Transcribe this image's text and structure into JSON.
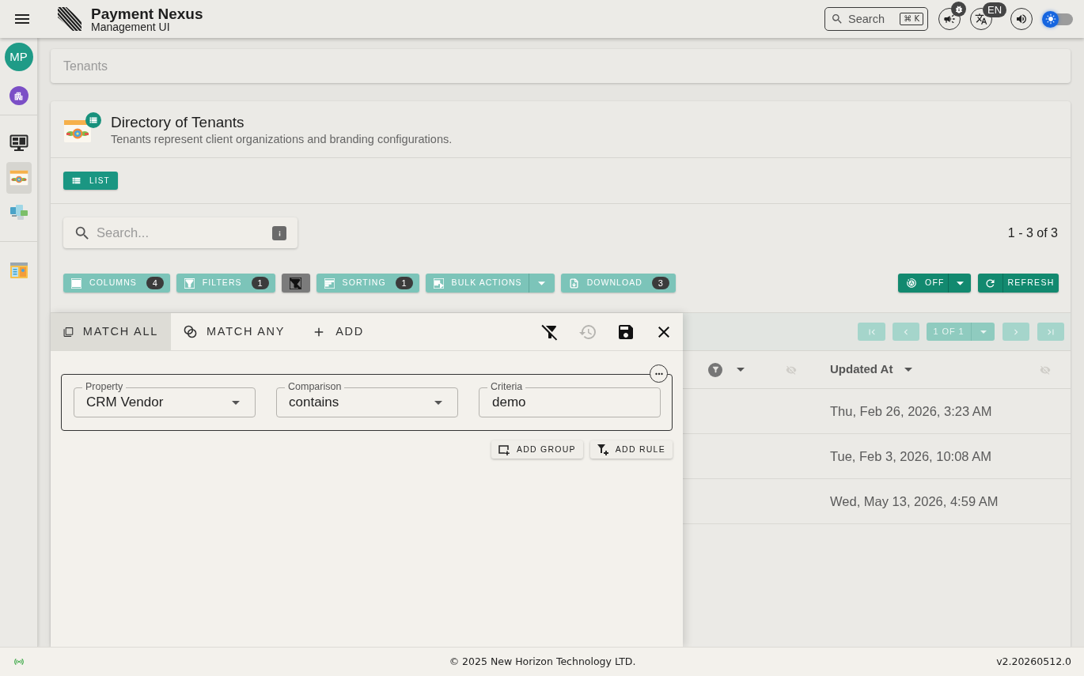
{
  "app": {
    "title": "Payment Nexus",
    "subtitle": "Management UI"
  },
  "top_bar": {
    "search": {
      "placeholder": "Search",
      "shortcut": "⌘ K"
    },
    "language": "EN",
    "theme_toggle": {
      "on": false
    }
  },
  "sidebar": {
    "avatar": "MP",
    "sections": [
      {
        "items": [
          {
            "kind": "monitor",
            "selected": false
          },
          {
            "kind": "calendar",
            "selected": true
          },
          {
            "kind": "devices",
            "selected": false
          }
        ]
      },
      {
        "items": [
          {
            "kind": "panels",
            "selected": false
          }
        ]
      }
    ]
  },
  "breadcrumb": [
    "Tenants"
  ],
  "page": {
    "title": "Directory of Tenants",
    "description": "Tenants represent client organizations and branding configurations.",
    "views": [
      {
        "label": "LIST",
        "selected": true
      }
    ]
  },
  "search": {
    "placeholder": "Search..."
  },
  "range": "1 - 3 of 3",
  "toolbar": {
    "buttons": [
      {
        "kind": "columns",
        "label": "COLUMNS",
        "count": "4"
      },
      {
        "kind": "filters",
        "label": "FILTERS",
        "count": "1"
      },
      {
        "kind": "clear_filters"
      },
      {
        "kind": "sorting",
        "label": "SORTING",
        "count": "1"
      },
      {
        "kind": "bulk_actions",
        "label": "BULK ACTIONS",
        "menu": true
      },
      {
        "kind": "download",
        "label": "DOWNLOAD",
        "count": "3"
      }
    ],
    "auto_refresh": {
      "label": "OFF"
    },
    "refresh": {
      "label": "REFRESH"
    }
  },
  "pagination": {
    "page": "1 OF 1",
    "disabled": true
  },
  "table": {
    "header": [
      {
        "filtered": true
      },
      {
        "label": "Updated At",
        "filtered": false
      }
    ],
    "rows": [
      {
        "updated_at": "Thu, Feb 26, 2026, 3:23 AM"
      },
      {
        "updated_at": "Tue, Feb 3, 2026, 10:08 AM"
      },
      {
        "updated_at": "Wed, May 13, 2026, 4:59 AM"
      }
    ]
  },
  "filter_panel": {
    "tabs": [
      {
        "label": "MATCH ALL",
        "selected": true
      },
      {
        "label": "MATCH ANY",
        "selected": false
      }
    ],
    "add_button": "ADD",
    "actions": [
      {
        "kind": "clear",
        "disabled": false
      },
      {
        "kind": "reset",
        "disabled": true
      },
      {
        "kind": "save",
        "disabled": false
      },
      {
        "kind": "close",
        "disabled": false
      }
    ],
    "groups": [
      {
        "rules": [
          {
            "property": {
              "label": "Property",
              "value": "CRM Vendor"
            },
            "comparison": {
              "label": "Comparison",
              "value": "contains"
            },
            "criteria": {
              "label": "Criteria",
              "value": "demo"
            }
          }
        ]
      }
    ],
    "group_buttons": [
      {
        "kind": "group",
        "label": "ADD GROUP"
      },
      {
        "kind": "rule",
        "label": "ADD RULE"
      }
    ]
  },
  "footer": {
    "connected": true,
    "copyright": "© 2025 New Horizon Technology LTD.",
    "version": "v2.20260512.0"
  }
}
